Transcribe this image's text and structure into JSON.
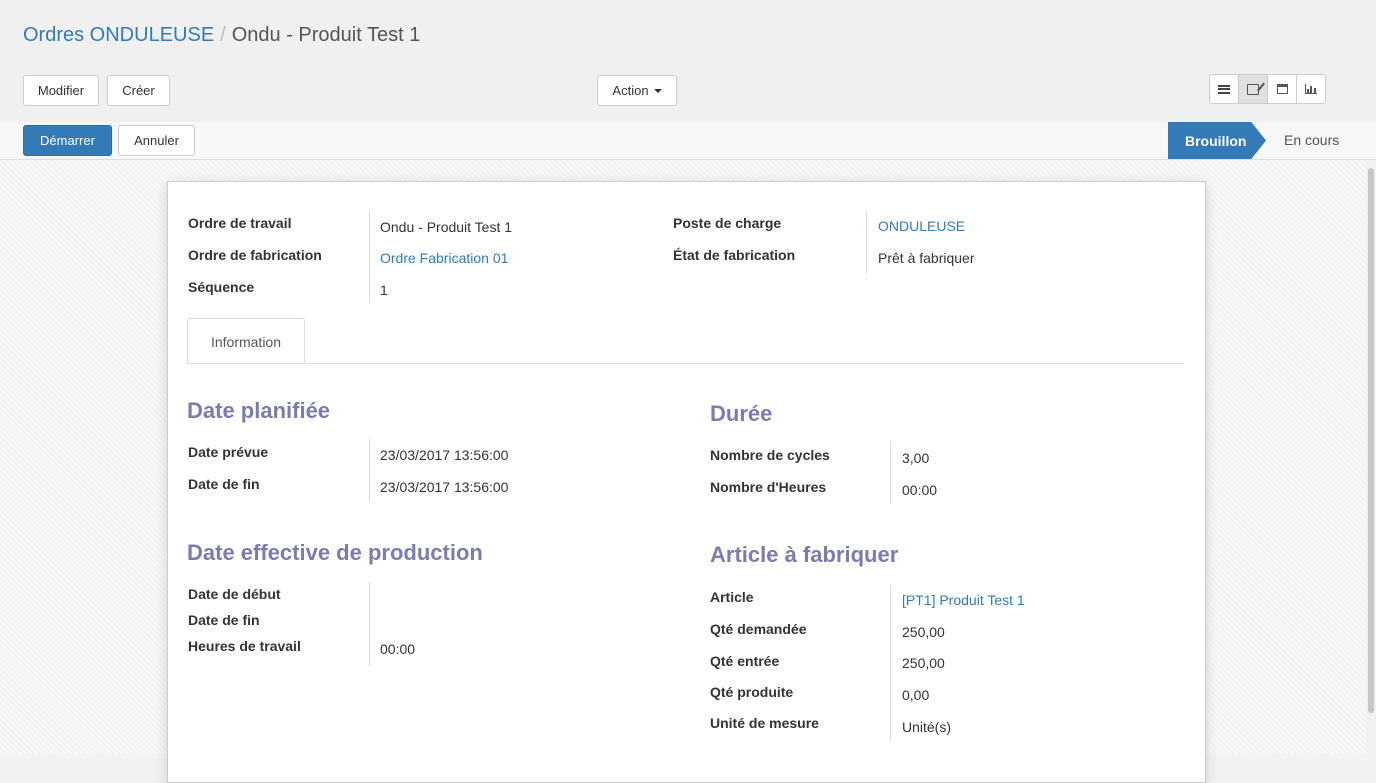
{
  "breadcrumb": {
    "parent": "Ordres ONDULEUSE",
    "separator": "/",
    "current": "Ondu - Produit Test 1"
  },
  "toolbar": {
    "edit": "Modifier",
    "create": "Créer",
    "action": "Action"
  },
  "view_switcher": {
    "active": "form",
    "icons": [
      "list-view-icon",
      "form-view-icon",
      "calendar-view-icon",
      "graph-view-icon"
    ]
  },
  "statusbar": {
    "start": "Démarrer",
    "cancel": "Annuler",
    "stages": [
      "Brouillon",
      "En cours"
    ],
    "active_stage": "Brouillon"
  },
  "header_fields": {
    "work_order": {
      "label": "Ordre de travail",
      "value": "Ondu - Produit Test 1"
    },
    "manufacturing_order": {
      "label": "Ordre de fabrication",
      "value": "Ordre Fabrication 01"
    },
    "sequence": {
      "label": "Séquence",
      "value": "1"
    },
    "workcenter": {
      "label": "Poste de charge",
      "value": "ONDULEUSE"
    },
    "production_state": {
      "label": "État de fabrication",
      "value": "Prêt à fabriquer"
    }
  },
  "tabs": [
    "Information"
  ],
  "planned": {
    "title": "Date planifiée",
    "start": {
      "label": "Date prévue",
      "value": "23/03/2017 13:56:00"
    },
    "end": {
      "label": "Date de fin",
      "value": "23/03/2017 13:56:00"
    }
  },
  "duration": {
    "title": "Durée",
    "cycles": {
      "label": "Nombre de cycles",
      "value": "3,00"
    },
    "hours": {
      "label": "Nombre d'Heures",
      "value": "00:00"
    }
  },
  "actual": {
    "title": "Date effective de production",
    "start": {
      "label": "Date de début",
      "value": ""
    },
    "end": {
      "label": "Date de fin",
      "value": ""
    },
    "work_hours": {
      "label": "Heures de travail",
      "value": "00:00"
    }
  },
  "product": {
    "title": "Article à fabriquer",
    "article": {
      "label": "Article",
      "value": "[PT1] Produit Test 1"
    },
    "qty_requested": {
      "label": "Qté demandée",
      "value": "250,00"
    },
    "qty_in": {
      "label": "Qté entrée",
      "value": "250,00"
    },
    "qty_produced": {
      "label": "Qté produite",
      "value": "0,00"
    },
    "uom": {
      "label": "Unité de mesure",
      "value": "Unité(s)"
    }
  },
  "colors": {
    "primary": "#337ab7",
    "section_title": "#7c7bad"
  }
}
